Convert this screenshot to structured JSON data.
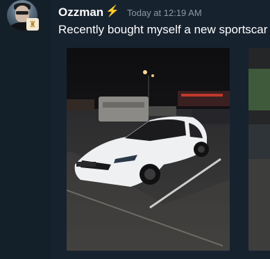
{
  "message": {
    "username": "Ozzman",
    "timestamp": "Today at 12:19 AM",
    "text": "Recently bought myself a new sportscar"
  },
  "icons": {
    "avatar": "user-avatar",
    "badge": "chess-rook-icon",
    "bolt": "lightning-bolt-icon"
  },
  "colors": {
    "background": "#17222f",
    "username": "#ffffff",
    "timestamp": "#8d99a6",
    "bolt": "#f6c443"
  }
}
